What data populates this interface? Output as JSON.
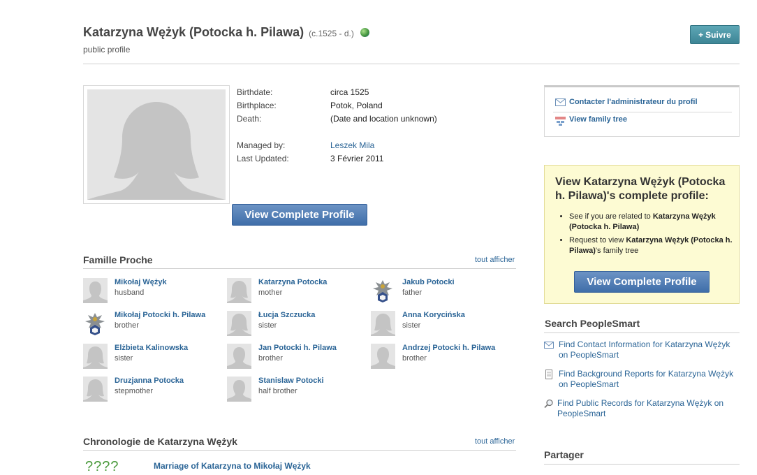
{
  "header": {
    "name": "Katarzyna Wężyk (Potocka h. Pilawa)",
    "dates": "(c.1525 - d.)",
    "subtitle": "public profile",
    "follow_label": "Suivre"
  },
  "facts": [
    {
      "label": "Birthdate:",
      "value": "circa 1525"
    },
    {
      "label": "Birthplace:",
      "value": "Potok, Poland"
    },
    {
      "label": "Death:",
      "value": "(Date and location unknown)"
    },
    {
      "label": "Managed by:",
      "value": "Leszek Mila"
    },
    {
      "label": "Last Updated:",
      "value": "3 Février 2011"
    }
  ],
  "view_complete_profile_label": "View Complete Profile",
  "family": {
    "title": "Famille Proche",
    "show_all": "tout afficher",
    "members": [
      {
        "name": "Mikołaj Wężyk",
        "relation": "husband",
        "icon": "silhouette-male"
      },
      {
        "name": "Katarzyna Potocka",
        "relation": "mother",
        "icon": "silhouette-female"
      },
      {
        "name": "Jakub Potocki",
        "relation": "father",
        "icon": "coat-of-arms"
      },
      {
        "name": "Mikołaj Potocki h. Pilawa",
        "relation": "brother",
        "icon": "coat-of-arms"
      },
      {
        "name": "Łucja Szczucka",
        "relation": "sister",
        "icon": "silhouette-female"
      },
      {
        "name": "Anna Korycińska",
        "relation": "sister",
        "icon": "silhouette-female"
      },
      {
        "name": "Elżbieta Kalinowska",
        "relation": "sister",
        "icon": "silhouette-female"
      },
      {
        "name": "Jan Potocki h. Pilawa",
        "relation": "brother",
        "icon": "silhouette-male"
      },
      {
        "name": "Andrzej Potocki h. Pilawa",
        "relation": "brother",
        "icon": "silhouette-male"
      },
      {
        "name": "Druzjanna Potocka",
        "relation": "stepmother",
        "icon": "silhouette-female"
      },
      {
        "name": "Stanislaw Potocki",
        "relation": "half brother",
        "icon": "silhouette-male"
      }
    ]
  },
  "chronology": {
    "title": "Chronologie de Katarzyna Wężyk",
    "show_all": "tout afficher",
    "first_year": "????",
    "first_event": "Marriage of Katarzyna to Mikołaj Wężyk"
  },
  "admin_box": {
    "contact_label": "Contacter l'administrateur du profil",
    "tree_label": "View family tree"
  },
  "promo": {
    "title": "View Katarzyna Wężyk (Potocka h. Pilawa)'s complete profile:",
    "bullet1_prefix": "See if you are related to ",
    "bullet1_name": "Katarzyna Wężyk (Potocka h. Pilawa)",
    "bullet2_prefix": "Request to view ",
    "bullet2_name": "Katarzyna Wężyk (Potocka h. Pilawa)",
    "bullet2_suffix": "'s family tree"
  },
  "search": {
    "title": "Search PeopleSmart",
    "items": [
      {
        "label": "Find Contact Information for Katarzyna Wężyk on PeopleSmart",
        "icon": "envelope-icon"
      },
      {
        "label": "Find Background Reports for Katarzyna Wężyk on PeopleSmart",
        "icon": "document-icon"
      },
      {
        "label": "Find Public Records for Katarzyna Wężyk on PeopleSmart",
        "icon": "magnifier-icon"
      }
    ]
  },
  "share": {
    "title": "Partager"
  },
  "colors": {
    "link": "#2a6496",
    "promo_bg": "#fdfbd3",
    "follow_bg": "#4a93a3",
    "button_blue": "#4f7db5"
  }
}
